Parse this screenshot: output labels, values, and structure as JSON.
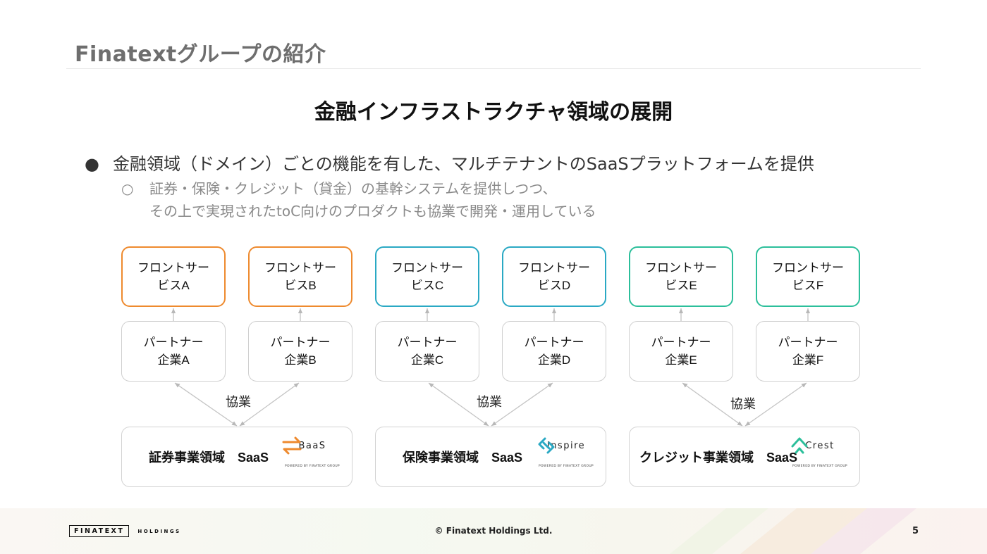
{
  "page_title": "Finatextグループの紹介",
  "subtitle": "金融インフラストラクチャ領域の展開",
  "bullets": {
    "main_marker": "●",
    "main_text": "金融領域（ドメイン）ごとの機能を有した、マルチテナントのSaaSプラットフォームを提供",
    "sub_marker": "○",
    "sub_line1": "証券・保険・クレジット（貸金）の基幹システムを提供しつつ、",
    "sub_line2": "その上で実現されたtoC向けのプロダクトも協業で開発・運用している"
  },
  "diagram": {
    "front_services": [
      {
        "line1": "フロントサー",
        "line2": "ビスA"
      },
      {
        "line1": "フロントサー",
        "line2": "ビスB"
      },
      {
        "line1": "フロントサー",
        "line2": "ビスC"
      },
      {
        "line1": "フロントサー",
        "line2": "ビスD"
      },
      {
        "line1": "フロントサー",
        "line2": "ビスE"
      },
      {
        "line1": "フロントサー",
        "line2": "ビスF"
      }
    ],
    "partners": [
      {
        "line1": "パートナー",
        "line2": "企業A"
      },
      {
        "line1": "パートナー",
        "line2": "企業B"
      },
      {
        "line1": "パートナー",
        "line2": "企業C"
      },
      {
        "line1": "パートナー",
        "line2": "企業D"
      },
      {
        "line1": "パートナー",
        "line2": "企業E"
      },
      {
        "line1": "パートナー",
        "line2": "企業F"
      }
    ],
    "collab_label": "協業",
    "saas": [
      {
        "name": "証券事業領域　SaaS",
        "logo_word": "BaaS",
        "logo_small": "POWERED BY FINATEXT GROUP",
        "icon": "exchange-arrows-icon",
        "color": "#ee8a2e"
      },
      {
        "name": "保険事業領域　SaaS",
        "logo_word": "Inspire",
        "logo_small": "POWERED BY FINATEXT GROUP",
        "icon": "linked-chevrons-icon",
        "color": "#2aa9c4"
      },
      {
        "name": "クレジット事業領域　SaaS",
        "logo_word": "Crest",
        "logo_small": "POWERED BY FINATEXT GROUP",
        "icon": "peak-caret-icon",
        "color": "#2cbf9b"
      }
    ],
    "colors": {
      "orange": "#ee8a2e",
      "blue": "#2aa9c4",
      "green": "#2cbf9b"
    }
  },
  "footer": {
    "logo_left": "FINATEXT",
    "logo_right": "HOLDINGS",
    "copyright": "© Finatext Holdings Ltd.",
    "page_number": "5"
  }
}
